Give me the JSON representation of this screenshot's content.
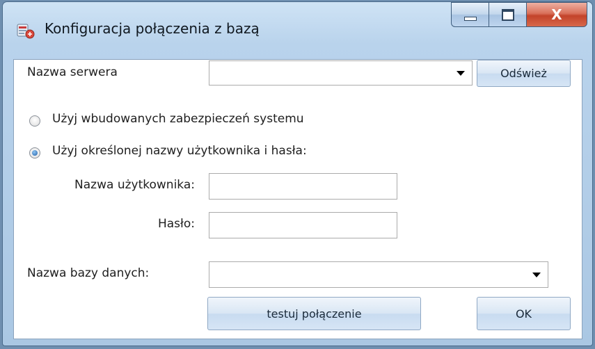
{
  "window": {
    "title": "Konfiguracja połączenia z bazą",
    "close_glyph": "X"
  },
  "icons": {
    "app": "database-connection-icon",
    "minimize": "minimize-icon",
    "maximize": "maximize-icon",
    "close": "close-icon",
    "dropdown": "chevron-down-icon"
  },
  "form": {
    "server_label": "Nazwa serwera",
    "server_value": "",
    "refresh_button": "Odśwież",
    "radio_integrated": {
      "label": "Użyj wbudowanych zabezpieczeń systemu",
      "checked": false
    },
    "radio_credentials": {
      "label": "Użyj określonej nazwy użytkownika i hasła:",
      "checked": true
    },
    "username_label": "Nazwa użytkownika:",
    "username_value": "",
    "password_label": "Hasło:",
    "password_value": "",
    "database_label": "Nazwa bazy danych:",
    "database_value": "",
    "test_button": "testuj połączenie",
    "ok_button": "OK"
  },
  "colors": {
    "titlebar": "#b9d3ec",
    "close_button": "#c3432a",
    "radio_dot": "#1e5fa8"
  }
}
